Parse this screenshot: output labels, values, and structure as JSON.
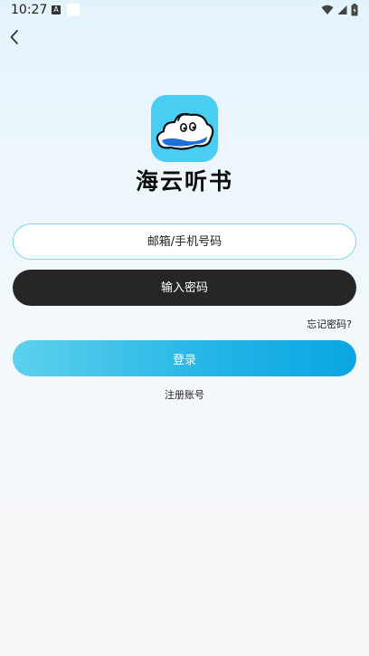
{
  "status_bar": {
    "time": "10:27",
    "notification_letter": "A",
    "icons": [
      "wifi-icon",
      "cell-signal-icon",
      "battery-icon"
    ]
  },
  "header": {
    "back_icon": "chevron-left-icon"
  },
  "app": {
    "logo_icon": "cloud-mascot-logo",
    "name": "海云听书"
  },
  "form": {
    "email_placeholder": "邮箱/手机号码",
    "email_value": "",
    "password_placeholder": "输入密码",
    "password_value": "",
    "forgot_label": "忘记密码?",
    "login_label": "登录",
    "register_label": "注册账号"
  },
  "colors": {
    "accent": "#22b4e6",
    "logo_bg": "#49cdf2",
    "input_border": "#7ad6ef",
    "password_bg": "#262626"
  }
}
